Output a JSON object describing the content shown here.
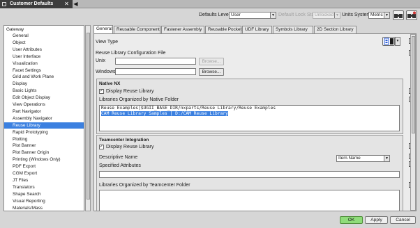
{
  "window": {
    "title": "Customer Defaults",
    "grip_icon": "grip-icon",
    "close_icon": "close-icon"
  },
  "toolbar": {
    "defaults_level_label": "Defaults Level",
    "defaults_level_value": "User",
    "lock_state_label": "Default Lock State",
    "lock_state_value": "Unlocked",
    "units_label": "Units System",
    "units_value": "Metric"
  },
  "tree": {
    "root": "Gateway",
    "items": [
      "General",
      "Object",
      "User Attributes",
      "User Interface",
      "Visualization",
      "Facet Settings",
      "Grid and Work Plane",
      "Display",
      "Basic Lights",
      "Edit Object Display",
      "View Operations",
      "Part Navigator",
      "Assembly Navigator",
      "Reuse Library",
      "Rapid Prototyping",
      "Plotting",
      "Plot Banner",
      "Plot Banner Origin",
      "Printing (Windows Only)",
      "PDF Export",
      "CGM Export",
      "JT Files",
      "Translators",
      "Shape Search",
      "Visual Reporting",
      "Materials/Mass"
    ],
    "selected_index": 13
  },
  "tabs": [
    "General",
    "Reusable Component",
    "Fastener Assembly",
    "Reusable Pocket",
    "UDF Library",
    "Symbols Library",
    "2D Section Library"
  ],
  "general": {
    "view_type_label": "View Type",
    "config_file_label": "Reuse Library Configuration File",
    "unix_label": "Unix",
    "unix_value": "",
    "windows_label": "Windows",
    "windows_value": "",
    "browse_label": "Browse...",
    "native_group_title": "Native NX",
    "native_display_label": "Display Reuse Library",
    "native_display_checked": true,
    "native_folder_label": "Libraries Organized by Native Folder",
    "native_folder_lines": [
      "Reuse Examples|$UGII_BASE_DIR/nxparts/Reuse Library/Reuse Examples",
      "CAM Reuse Library Samples | D:/CAM Reuse Library"
    ],
    "tc_group_title": "Teamcenter Integration",
    "tc_display_label": "Display Reuse Library",
    "tc_display_checked": true,
    "descriptive_name_label": "Descriptive Name",
    "descriptive_name_value": "Item.Name",
    "specified_attributes_label": "Specified Attributes",
    "tc_folder_label": "Libraries Organized by Teamcenter Folder",
    "help_glyph": "?"
  },
  "buttons": {
    "ok": "OK",
    "apply": "Apply",
    "cancel": "Cancel"
  },
  "colors": {
    "selection": "#3b80e0",
    "ok_button": "#8fdc7a"
  }
}
